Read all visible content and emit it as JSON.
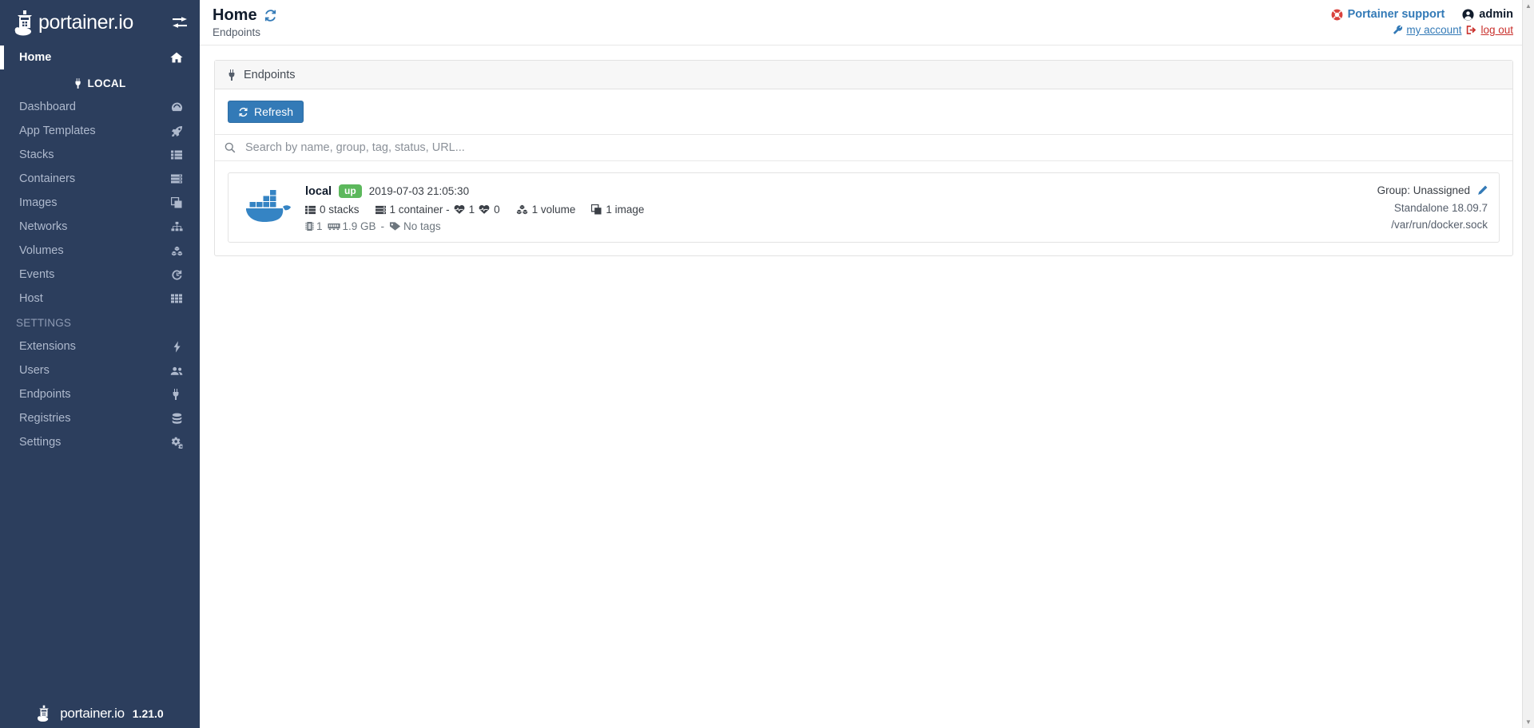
{
  "brand": {
    "name": "portainer.io",
    "toggle_icon": "toggle-sidebar-icon",
    "footer_name": "portainer.io",
    "version": "1.21.0"
  },
  "sidebar": {
    "home": {
      "label": "Home",
      "icon": "home-icon"
    },
    "local_section": {
      "label": "LOCAL",
      "icon": "plug-icon"
    },
    "settings_section": {
      "label": "SETTINGS"
    },
    "local_items": [
      {
        "label": "Dashboard",
        "icon": "tachometer-icon"
      },
      {
        "label": "App Templates",
        "icon": "rocket-icon"
      },
      {
        "label": "Stacks",
        "icon": "th-list-icon"
      },
      {
        "label": "Containers",
        "icon": "server-icon"
      },
      {
        "label": "Images",
        "icon": "clone-icon"
      },
      {
        "label": "Networks",
        "icon": "sitemap-icon"
      },
      {
        "label": "Volumes",
        "icon": "cubes-icon"
      },
      {
        "label": "Events",
        "icon": "history-icon"
      },
      {
        "label": "Host",
        "icon": "th-icon"
      }
    ],
    "settings_items": [
      {
        "label": "Extensions",
        "icon": "bolt-icon"
      },
      {
        "label": "Users",
        "icon": "users-icon"
      },
      {
        "label": "Endpoints",
        "icon": "plug-icon"
      },
      {
        "label": "Registries",
        "icon": "database-icon"
      },
      {
        "label": "Settings",
        "icon": "gears-icon"
      }
    ]
  },
  "header": {
    "title": "Home",
    "refresh_icon": "refresh-icon",
    "breadcrumb": "Endpoints",
    "support_label": "Portainer support",
    "support_icon": "life-ring-icon",
    "username": "admin",
    "user_icon": "user-circle-icon",
    "my_account_label": "my account",
    "my_account_icon": "wrench-icon",
    "logout_label": "log out",
    "logout_icon": "sign-out-icon"
  },
  "panel": {
    "title": "Endpoints",
    "title_icon": "plug-icon",
    "refresh_button": "Refresh",
    "refresh_button_icon": "sync-icon",
    "search_placeholder": "Search by name, group, tag, status, URL...",
    "search_value": "",
    "search_icon": "search-icon"
  },
  "endpoints": [
    {
      "logo": "docker-whale-icon",
      "name": "local",
      "status": "up",
      "datetime": "2019-07-03 21:05:30",
      "stacks": "0 stacks",
      "stacks_icon": "th-list-icon",
      "containers": "1 container -",
      "containers_icon": "server-icon",
      "healthy_count": "1",
      "healthy_icon": "heartbeat-green-icon",
      "unhealthy_count": "0",
      "unhealthy_icon": "heartbeat-red-icon",
      "volumes": "1 volume",
      "volumes_icon": "cubes-icon",
      "images": "1 image",
      "images_icon": "clone-icon",
      "cpu": "1",
      "cpu_icon": "microchip-icon",
      "memory": "1.9 GB",
      "memory_icon": "memory-icon",
      "separator": "-",
      "tags": "No tags",
      "tags_icon": "tags-icon",
      "group": "Group: Unassigned",
      "group_edit_icon": "pencil-icon",
      "engine": "Standalone 18.09.7",
      "url": "/var/run/docker.sock"
    }
  ],
  "colors": {
    "sidebar_bg": "#2c3e5d",
    "accent_blue": "#337ab7",
    "status_up_green": "#5cb85c",
    "heartbeat_green": "#3bb77e",
    "heartbeat_red": "#d9413c",
    "logout_red": "#c9302c",
    "docker_blue": "#3584c4"
  }
}
